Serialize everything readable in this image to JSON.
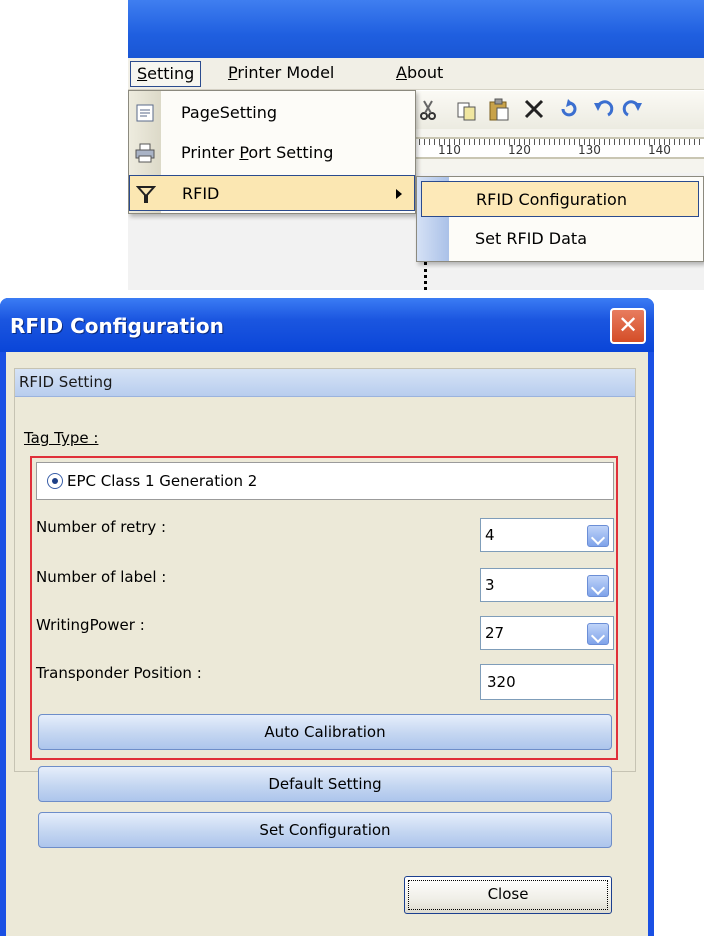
{
  "menubar": {
    "items": [
      {
        "label_underlined": "S",
        "label_rest": "etting"
      },
      {
        "label_underlined": "P",
        "label_rest": "rinter Model"
      },
      {
        "label_underlined": "A",
        "label_rest": "bout"
      }
    ]
  },
  "ruler": {
    "ticks": [
      "110",
      "120",
      "130",
      "140"
    ]
  },
  "setting_menu": {
    "items": [
      {
        "label_pre": "Pa",
        "label_underlined": "g",
        "label_post": "eSetting",
        "icon": "page-setting-icon"
      },
      {
        "label_pre": "Printer ",
        "label_underlined": "P",
        "label_post": "ort Setting",
        "icon": "printer-icon"
      },
      {
        "label_pre": "RFID",
        "label_underlined": "",
        "label_post": "",
        "icon": "filter-icon"
      }
    ]
  },
  "rfid_submenu": {
    "items": [
      "RFID Configuration",
      "Set RFID Data"
    ]
  },
  "dialog": {
    "title": "RFID Configuration",
    "group_title": "RFID Setting",
    "tag_type_label": "Tag Type :",
    "tag_type_value": "EPC Class 1 Generation 2",
    "retry_label": "Number of retry :",
    "retry_value": "4",
    "label_count_label": "Number of label :",
    "label_count_value": "3",
    "writing_power_label": "WritingPower :",
    "writing_power_value": "27",
    "transponder_label": "Transponder Position :",
    "transponder_value": "320",
    "auto_calibration": "Auto Calibration",
    "default_setting": "Default Setting",
    "set_configuration": "Set Configuration",
    "close": "Close"
  },
  "colors": {
    "title_blue": "#1b56e0",
    "highlight_border": "#e0303a",
    "close_red": "#d44d27"
  }
}
